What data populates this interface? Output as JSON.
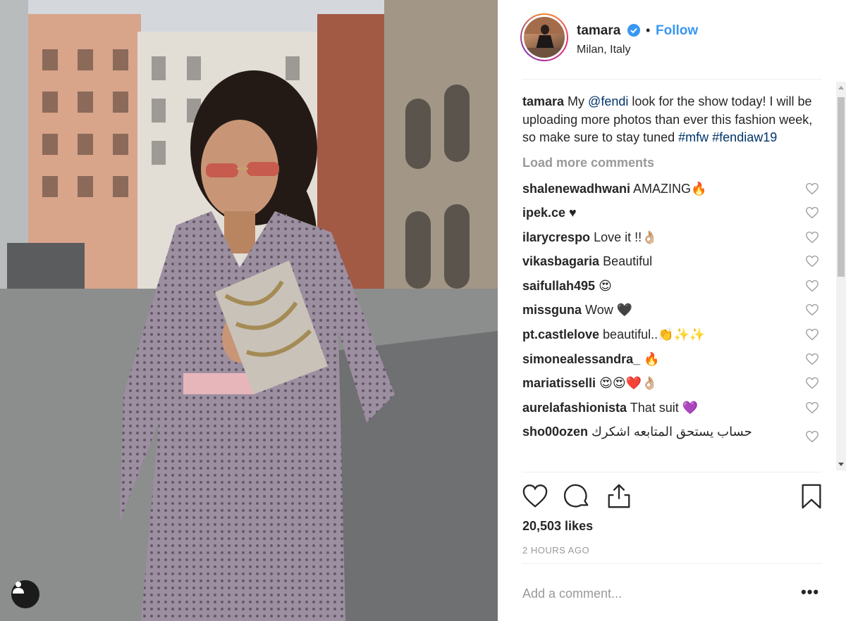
{
  "colors": {
    "accent": "#3897f0",
    "link": "#003569",
    "muted": "#999999",
    "text": "#262626"
  },
  "post": {
    "username": "tamara",
    "follow_label": "Follow",
    "separator": "•",
    "location": "Milan, Italy",
    "verified_icon": "verified-badge-icon"
  },
  "caption": {
    "username": "tamara",
    "text_1": " My ",
    "mention": "@fendi",
    "text_2": " look for the show today! I will be uploading more photos than ever this fashion week, so make sure to stay tuned ",
    "hashtag_1": "#mfw",
    "space": " ",
    "hashtag_2": "#fendiaw19"
  },
  "load_more": "Load more comments",
  "comments": [
    {
      "user": "shalenewadhwani",
      "text": " AMAZING🔥"
    },
    {
      "user": "ipek.ce",
      "text": " ♥"
    },
    {
      "user": "ilarycrespo",
      "text": " Love it !!👌🏼"
    },
    {
      "user": "vikasbagaria",
      "text": " Beautiful"
    },
    {
      "user": "saifullah495",
      "text": " 😍"
    },
    {
      "user": "missguna",
      "text": " Wow 🖤"
    },
    {
      "user": "pt.castlelove",
      "text": " beautiful..👏✨✨"
    },
    {
      "user": "simonealessandra_",
      "text": " 🔥"
    },
    {
      "user": "mariatisselli",
      "text": " 😍😍❤️👌🏼"
    },
    {
      "user": "aurelafashionista",
      "text": " That suit 💜"
    },
    {
      "user": "sho00ozen",
      "text": " حساب يستحق المتابعه اشكرك"
    }
  ],
  "likes": "20,503 likes",
  "timestamp": "2 HOURS AGO",
  "add_comment_placeholder": "Add a comment...",
  "more_options": "•••",
  "icons": {
    "like": "heart-icon",
    "comment": "comment-bubble-icon",
    "share": "share-icon",
    "save": "bookmark-icon",
    "user_tag": "user-tag-icon"
  }
}
